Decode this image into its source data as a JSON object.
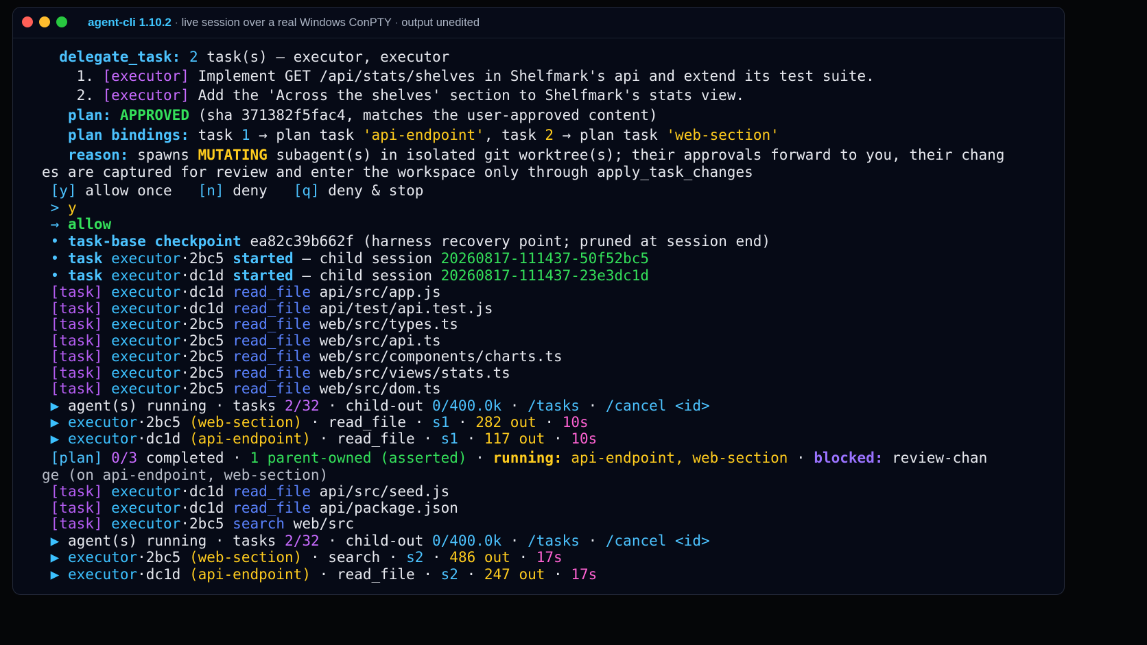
{
  "window": {
    "app_name": "agent-cli 1.10.2",
    "subtitle_sep": " · ",
    "subtitle_1": "live session over a real Windows ConPTY",
    "subtitle_2": "output unedited"
  },
  "colors": {
    "background": "#060a16",
    "blue": "#4cc3ff",
    "magenta": "#c86bff",
    "green": "#34e05a",
    "yellow": "#ffcc1e",
    "pink": "#ff63d3",
    "purple": "#9a73ff"
  },
  "lines": [
    {
      "indent": "  ",
      "segs": [
        {
          "t": "delegate_task:",
          "c": "c-bblue"
        },
        {
          "t": " ",
          "c": ""
        },
        {
          "t": "2",
          "c": "c-blue"
        },
        {
          "t": " task(s) – executor, executor",
          "c": "c-white"
        }
      ]
    },
    {
      "indent": "    ",
      "segs": [
        {
          "t": "1. ",
          "c": "c-white"
        },
        {
          "t": "[executor]",
          "c": "c-mag"
        },
        {
          "t": " Implement GET /api/stats/shelves in Shelfmark's api and extend its test suite.",
          "c": "c-white"
        }
      ]
    },
    {
      "indent": "    ",
      "segs": [
        {
          "t": "2. ",
          "c": "c-white"
        },
        {
          "t": "[executor]",
          "c": "c-mag"
        },
        {
          "t": " Add the 'Across the shelves' section to Shelfmark's stats view.",
          "c": "c-white"
        }
      ]
    },
    {
      "indent": "   ",
      "segs": [
        {
          "t": "plan:",
          "c": "c-bblue"
        },
        {
          "t": " ",
          "c": ""
        },
        {
          "t": "APPROVED",
          "c": "c-bgreen"
        },
        {
          "t": " (sha 371382f5fac4, matches the user-approved content)",
          "c": "c-white"
        }
      ]
    },
    {
      "indent": "   ",
      "segs": [
        {
          "t": "plan bindings:",
          "c": "c-bblue"
        },
        {
          "t": " task ",
          "c": "c-white"
        },
        {
          "t": "1",
          "c": "c-blue"
        },
        {
          "t": " → plan task ",
          "c": "c-white"
        },
        {
          "t": "'api-endpoint'",
          "c": "c-yellow"
        },
        {
          "t": ", task ",
          "c": "c-white"
        },
        {
          "t": "2",
          "c": "c-yellow"
        },
        {
          "t": " → plan task ",
          "c": "c-white"
        },
        {
          "t": "'web-section'",
          "c": "c-yellow"
        }
      ]
    },
    {
      "indent": "   ",
      "segs": [
        {
          "t": "reason:",
          "c": "c-bblue"
        },
        {
          "t": " spawns ",
          "c": "c-white"
        },
        {
          "t": "MUTATING",
          "c": "c-ybold"
        },
        {
          "t": " subagent(s) in isolated git worktree(s); their approvals forward to you, their chang",
          "c": "c-white"
        }
      ]
    },
    {
      "indent": "",
      "segs": [
        {
          "t": "es are captured for review and enter the workspace only through apply_task_changes",
          "c": "c-white"
        }
      ]
    },
    {
      "indent": " ",
      "segs": [
        {
          "t": "[y]",
          "c": "c-blue"
        },
        {
          "t": " allow once   ",
          "c": "c-white"
        },
        {
          "t": "[n]",
          "c": "c-blue"
        },
        {
          "t": " deny   ",
          "c": "c-white"
        },
        {
          "t": "[q]",
          "c": "c-blue"
        },
        {
          "t": " deny & stop",
          "c": "c-white"
        }
      ]
    },
    {
      "indent": " ",
      "segs": [
        {
          "t": "> ",
          "c": "c-blue"
        },
        {
          "t": "y",
          "c": "c-yellow"
        }
      ]
    },
    {
      "indent": " ",
      "segs": [
        {
          "t": "→ ",
          "c": "c-blue"
        },
        {
          "t": "allow",
          "c": "c-bgreen"
        }
      ]
    },
    {
      "indent": " ",
      "segs": [
        {
          "t": "• ",
          "c": "c-blue"
        },
        {
          "t": "task-base checkpoint",
          "c": "c-bblue"
        },
        {
          "t": " ea82c39b662f (harness recovery point; pruned at session end)",
          "c": "c-white"
        }
      ]
    },
    {
      "indent": " ",
      "segs": [
        {
          "t": "• ",
          "c": "c-blue"
        },
        {
          "t": "task",
          "c": "c-bblue"
        },
        {
          "t": " executor",
          "c": "c-exec"
        },
        {
          "t": "·2bc5 ",
          "c": "c-white"
        },
        {
          "t": "started",
          "c": "c-bblue"
        },
        {
          "t": " – child session ",
          "c": "c-white"
        },
        {
          "t": "20260817-111437-50f52bc5",
          "c": "c-green"
        }
      ]
    },
    {
      "indent": " ",
      "segs": [
        {
          "t": "• ",
          "c": "c-blue"
        },
        {
          "t": "task",
          "c": "c-bblue"
        },
        {
          "t": " executor",
          "c": "c-exec"
        },
        {
          "t": "·dc1d ",
          "c": "c-white"
        },
        {
          "t": "started",
          "c": "c-bblue"
        },
        {
          "t": " – child session ",
          "c": "c-white"
        },
        {
          "t": "20260817-111437-23e3dc1d",
          "c": "c-green"
        }
      ]
    },
    {
      "indent": " ",
      "segs": [
        {
          "t": "[task]",
          "c": "c-task"
        },
        {
          "t": " executor",
          "c": "c-exec"
        },
        {
          "t": "·dc1d ",
          "c": "c-white"
        },
        {
          "t": "read_file",
          "c": "c-rf"
        },
        {
          "t": " api/src/app.js",
          "c": "c-white"
        }
      ]
    },
    {
      "indent": " ",
      "segs": [
        {
          "t": "[task]",
          "c": "c-task"
        },
        {
          "t": " executor",
          "c": "c-exec"
        },
        {
          "t": "·dc1d ",
          "c": "c-white"
        },
        {
          "t": "read_file",
          "c": "c-rf"
        },
        {
          "t": " api/test/api.test.js",
          "c": "c-white"
        }
      ]
    },
    {
      "indent": " ",
      "segs": [
        {
          "t": "[task]",
          "c": "c-task"
        },
        {
          "t": " executor",
          "c": "c-exec"
        },
        {
          "t": "·2bc5 ",
          "c": "c-white"
        },
        {
          "t": "read_file",
          "c": "c-rf"
        },
        {
          "t": " web/src/types.ts",
          "c": "c-white"
        }
      ]
    },
    {
      "indent": " ",
      "segs": [
        {
          "t": "[task]",
          "c": "c-task"
        },
        {
          "t": " executor",
          "c": "c-exec"
        },
        {
          "t": "·2bc5 ",
          "c": "c-white"
        },
        {
          "t": "read_file",
          "c": "c-rf"
        },
        {
          "t": " web/src/api.ts",
          "c": "c-white"
        }
      ]
    },
    {
      "indent": " ",
      "segs": [
        {
          "t": "[task]",
          "c": "c-task"
        },
        {
          "t": " executor",
          "c": "c-exec"
        },
        {
          "t": "·2bc5 ",
          "c": "c-white"
        },
        {
          "t": "read_file",
          "c": "c-rf"
        },
        {
          "t": " web/src/components/charts.ts",
          "c": "c-white"
        }
      ]
    },
    {
      "indent": " ",
      "segs": [
        {
          "t": "[task]",
          "c": "c-task"
        },
        {
          "t": " executor",
          "c": "c-exec"
        },
        {
          "t": "·2bc5 ",
          "c": "c-white"
        },
        {
          "t": "read_file",
          "c": "c-rf"
        },
        {
          "t": " web/src/views/stats.ts",
          "c": "c-white"
        }
      ]
    },
    {
      "indent": " ",
      "segs": [
        {
          "t": "[task]",
          "c": "c-task"
        },
        {
          "t": " executor",
          "c": "c-exec"
        },
        {
          "t": "·2bc5 ",
          "c": "c-white"
        },
        {
          "t": "read_file",
          "c": "c-rf"
        },
        {
          "t": " web/src/dom.ts",
          "c": "c-white"
        }
      ]
    },
    {
      "indent": " ",
      "segs": [
        {
          "t": "▶",
          "c": "c-arrow"
        },
        {
          "t": " agent(s) running · tasks ",
          "c": "c-white"
        },
        {
          "t": "2/32",
          "c": "c-mag"
        },
        {
          "t": " · child-out ",
          "c": "c-white"
        },
        {
          "t": "0/400.0k",
          "c": "c-blue"
        },
        {
          "t": " · ",
          "c": "c-white"
        },
        {
          "t": "/tasks",
          "c": "c-blue"
        },
        {
          "t": " · ",
          "c": "c-white"
        },
        {
          "t": "/cancel <id>",
          "c": "c-blue"
        }
      ]
    },
    {
      "indent": " ",
      "segs": [
        {
          "t": "▶",
          "c": "c-arrow"
        },
        {
          "t": " executor",
          "c": "c-exec"
        },
        {
          "t": "·2bc5 ",
          "c": "c-white"
        },
        {
          "t": "(web-section)",
          "c": "c-yellow"
        },
        {
          "t": " · read_file · ",
          "c": "c-white"
        },
        {
          "t": "s1",
          "c": "c-blue"
        },
        {
          "t": " · ",
          "c": "c-white"
        },
        {
          "t": "282 out",
          "c": "c-yellow"
        },
        {
          "t": " · ",
          "c": "c-white"
        },
        {
          "t": "10s",
          "c": "c-pink"
        }
      ]
    },
    {
      "indent": " ",
      "segs": [
        {
          "t": "▶",
          "c": "c-arrow"
        },
        {
          "t": " executor",
          "c": "c-exec"
        },
        {
          "t": "·dc1d ",
          "c": "c-white"
        },
        {
          "t": "(api-endpoint)",
          "c": "c-yellow"
        },
        {
          "t": " · read_file · ",
          "c": "c-white"
        },
        {
          "t": "s1",
          "c": "c-blue"
        },
        {
          "t": " · ",
          "c": "c-white"
        },
        {
          "t": "117 out",
          "c": "c-yellow"
        },
        {
          "t": " · ",
          "c": "c-white"
        },
        {
          "t": "10s",
          "c": "c-pink"
        }
      ]
    },
    {
      "indent": " ",
      "segs": [
        {
          "t": "[plan]",
          "c": "c-blue"
        },
        {
          "t": " ",
          "c": ""
        },
        {
          "t": "0/3",
          "c": "c-mag"
        },
        {
          "t": " completed · ",
          "c": "c-white"
        },
        {
          "t": "1",
          "c": "c-green"
        },
        {
          "t": " parent-owned (asserted)",
          "c": "c-green"
        },
        {
          "t": " · ",
          "c": "c-white"
        },
        {
          "t": "running:",
          "c": "c-ybold"
        },
        {
          "t": " api-endpoint, web-section",
          "c": "c-yellow"
        },
        {
          "t": " · ",
          "c": "c-white"
        },
        {
          "t": "blocked:",
          "c": "c-purple"
        },
        {
          "t": " review-chan",
          "c": "c-white"
        }
      ]
    },
    {
      "indent": "",
      "segs": [
        {
          "t": "ge (on api-endpoint, web-section)",
          "c": "c-gray"
        }
      ]
    },
    {
      "indent": " ",
      "segs": [
        {
          "t": "[task]",
          "c": "c-task"
        },
        {
          "t": " executor",
          "c": "c-exec"
        },
        {
          "t": "·dc1d ",
          "c": "c-white"
        },
        {
          "t": "read_file",
          "c": "c-rf"
        },
        {
          "t": " api/src/seed.js",
          "c": "c-white"
        }
      ]
    },
    {
      "indent": " ",
      "segs": [
        {
          "t": "[task]",
          "c": "c-task"
        },
        {
          "t": " executor",
          "c": "c-exec"
        },
        {
          "t": "·dc1d ",
          "c": "c-white"
        },
        {
          "t": "read_file",
          "c": "c-rf"
        },
        {
          "t": " api/package.json",
          "c": "c-white"
        }
      ]
    },
    {
      "indent": " ",
      "segs": [
        {
          "t": "[task]",
          "c": "c-task"
        },
        {
          "t": " executor",
          "c": "c-exec"
        },
        {
          "t": "·2bc5 ",
          "c": "c-white"
        },
        {
          "t": "search",
          "c": "c-rf"
        },
        {
          "t": " web/src",
          "c": "c-white"
        }
      ]
    },
    {
      "indent": " ",
      "segs": [
        {
          "t": "▶",
          "c": "c-arrow"
        },
        {
          "t": " agent(s) running · tasks ",
          "c": "c-white"
        },
        {
          "t": "2/32",
          "c": "c-mag"
        },
        {
          "t": " · child-out ",
          "c": "c-white"
        },
        {
          "t": "0/400.0k",
          "c": "c-blue"
        },
        {
          "t": " · ",
          "c": "c-white"
        },
        {
          "t": "/tasks",
          "c": "c-blue"
        },
        {
          "t": " · ",
          "c": "c-white"
        },
        {
          "t": "/cancel <id>",
          "c": "c-blue"
        }
      ]
    },
    {
      "indent": " ",
      "segs": [
        {
          "t": "▶",
          "c": "c-arrow"
        },
        {
          "t": " executor",
          "c": "c-exec"
        },
        {
          "t": "·2bc5 ",
          "c": "c-white"
        },
        {
          "t": "(web-section)",
          "c": "c-yellow"
        },
        {
          "t": " · search · ",
          "c": "c-white"
        },
        {
          "t": "s2",
          "c": "c-blue"
        },
        {
          "t": " · ",
          "c": "c-white"
        },
        {
          "t": "486 out",
          "c": "c-yellow"
        },
        {
          "t": " · ",
          "c": "c-white"
        },
        {
          "t": "17s",
          "c": "c-pink"
        }
      ]
    },
    {
      "indent": " ",
      "segs": [
        {
          "t": "▶",
          "c": "c-arrow"
        },
        {
          "t": " executor",
          "c": "c-exec"
        },
        {
          "t": "·dc1d ",
          "c": "c-white"
        },
        {
          "t": "(api-endpoint)",
          "c": "c-yellow"
        },
        {
          "t": " · read_file · ",
          "c": "c-white"
        },
        {
          "t": "s2",
          "c": "c-blue"
        },
        {
          "t": " · ",
          "c": "c-white"
        },
        {
          "t": "247 out",
          "c": "c-yellow"
        },
        {
          "t": " · ",
          "c": "c-white"
        },
        {
          "t": "17s",
          "c": "c-pink"
        }
      ]
    }
  ]
}
